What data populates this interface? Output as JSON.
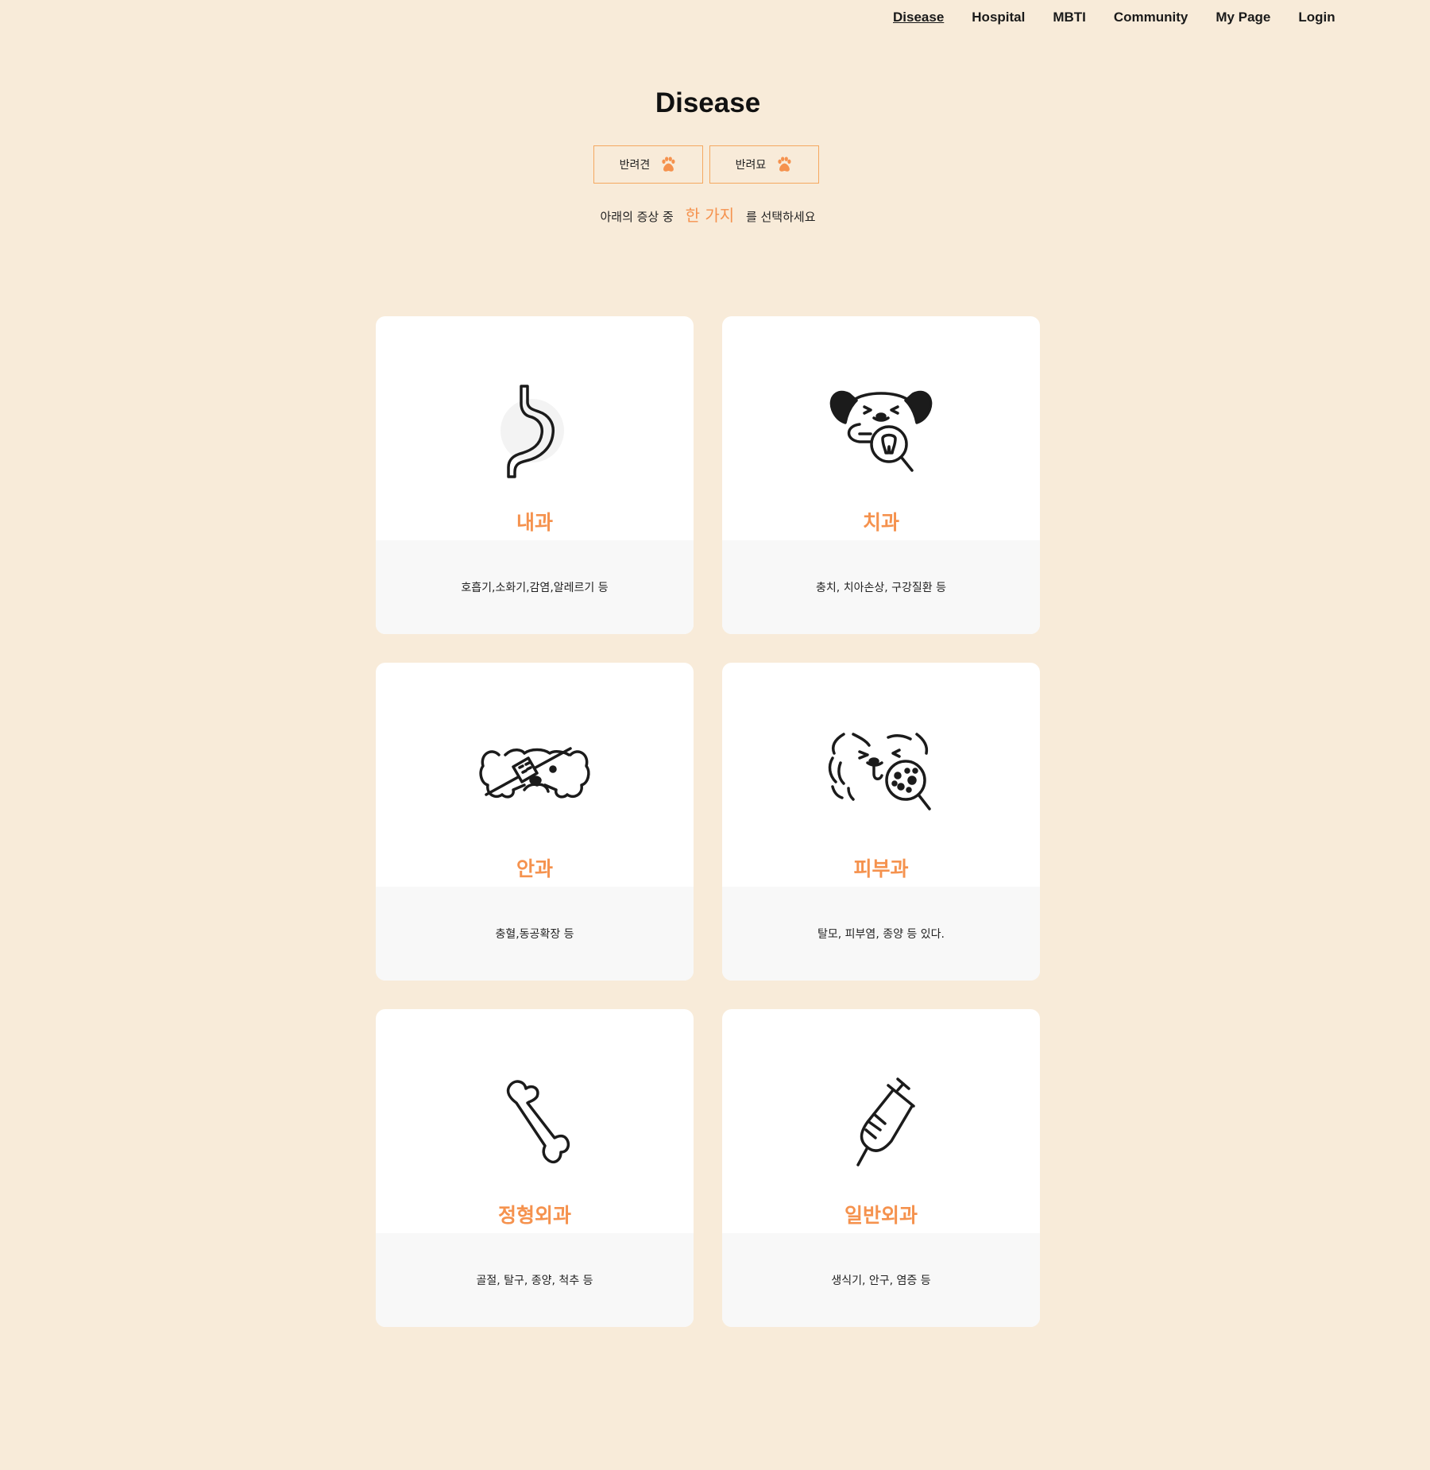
{
  "nav": {
    "items": [
      {
        "label": "Disease",
        "active": true
      },
      {
        "label": "Hospital"
      },
      {
        "label": "MBTI"
      },
      {
        "label": "Community"
      },
      {
        "label": "My Page"
      },
      {
        "label": "Login"
      }
    ]
  },
  "header": {
    "title": "Disease"
  },
  "pet_tabs": [
    {
      "label": "반려견",
      "icon": "paw-icon"
    },
    {
      "label": "반려묘",
      "icon": "paw-icon"
    }
  ],
  "instruction": {
    "before": "아래의 증상 중",
    "highlight": "한 가지",
    "after": "를 선택하세요"
  },
  "cards": [
    {
      "title": "내과",
      "description": "호흡기,소화기,감염,알레르기 등",
      "icon": "stomach-icon"
    },
    {
      "title": "치과",
      "description": "충치, 치아손상, 구강질환 등",
      "icon": "dog-tooth-icon"
    },
    {
      "title": "안과",
      "description": "충혈,동공확장 등",
      "icon": "dog-eye-bandage-icon"
    },
    {
      "title": "피부과",
      "description": "탈모, 피부염, 종양 등 있다.",
      "icon": "dog-skin-icon"
    },
    {
      "title": "정형외과",
      "description": "골절, 탈구, 종양, 척추 등",
      "icon": "bone-icon"
    },
    {
      "title": "일반외과",
      "description": "생식기, 안구, 염증 등",
      "icon": "syringe-icon"
    }
  ],
  "colors": {
    "background": "#f8ebd9",
    "accent": "#f5924e",
    "card": "#ffffff",
    "card_footer": "#f8f8f8"
  }
}
